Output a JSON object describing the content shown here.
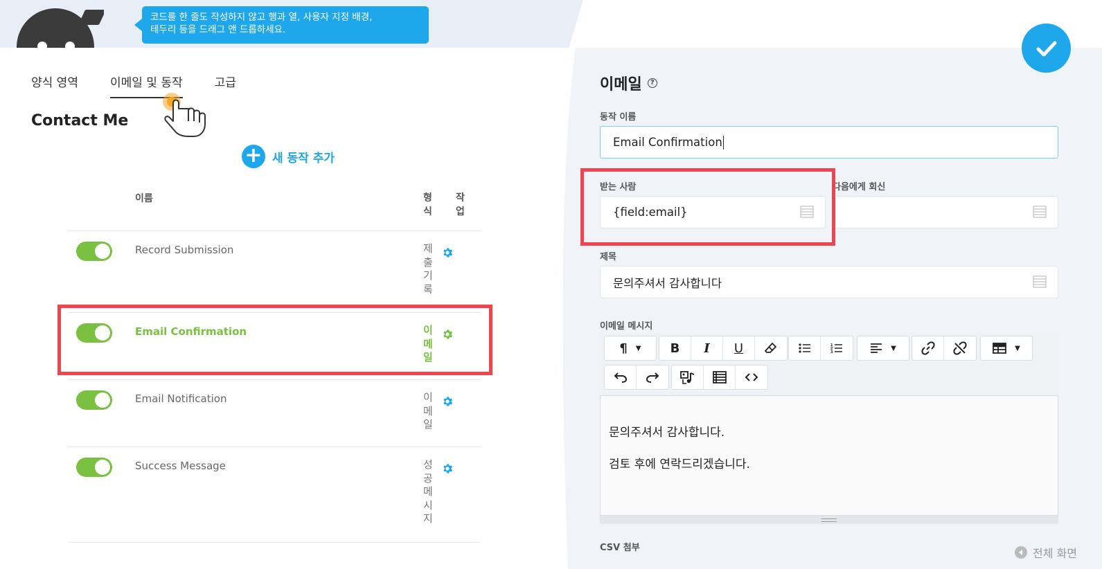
{
  "banner": {
    "tooltip_line1": "코드를 한 줄도 작성하지 않고 행과 열, 사용자 지정 배경,",
    "tooltip_line2": "테두리 등을 드래그 앤 드롭하세요."
  },
  "tabs": [
    {
      "label": "양식 영역"
    },
    {
      "label": "이메일 및 동작"
    },
    {
      "label": "고급"
    }
  ],
  "form_title": "Contact Me",
  "add_action_label": "새 동작 추가",
  "table": {
    "col_name": "이름",
    "col_type": "형식",
    "col_actions": "작업",
    "rows": [
      {
        "name": "Record Submission",
        "type": "제출기록"
      },
      {
        "name": "Email Confirmation",
        "type": "이메일"
      },
      {
        "name": "Email Notification",
        "type": "이메일"
      },
      {
        "name": "Success Message",
        "type": "성공메시지"
      }
    ]
  },
  "panel": {
    "title": "이메일",
    "help_icon": "?",
    "action_name_label": "동작 이름",
    "action_name_value": "Email Confirmation",
    "to_label": "받는 사람",
    "to_value": "{field:email}",
    "reply_to_label": "다음에게 회신",
    "reply_to_value": "",
    "subject_label": "제목",
    "subject_value": "문의주셔서 감사합니다",
    "message_label": "이메일 메시지",
    "message_line1": "문의주셔서 감사합니다.",
    "message_line2": "검토 후에 연락드리겠습니다.",
    "csv_label": "CSV 첨부",
    "fullscreen_label": "전체 화면"
  },
  "colors": {
    "accent_blue": "#1ea7ea",
    "toggle_green": "#7ac142",
    "highlight_red": "#f0454f",
    "panel_bg": "#f0f3f8"
  }
}
